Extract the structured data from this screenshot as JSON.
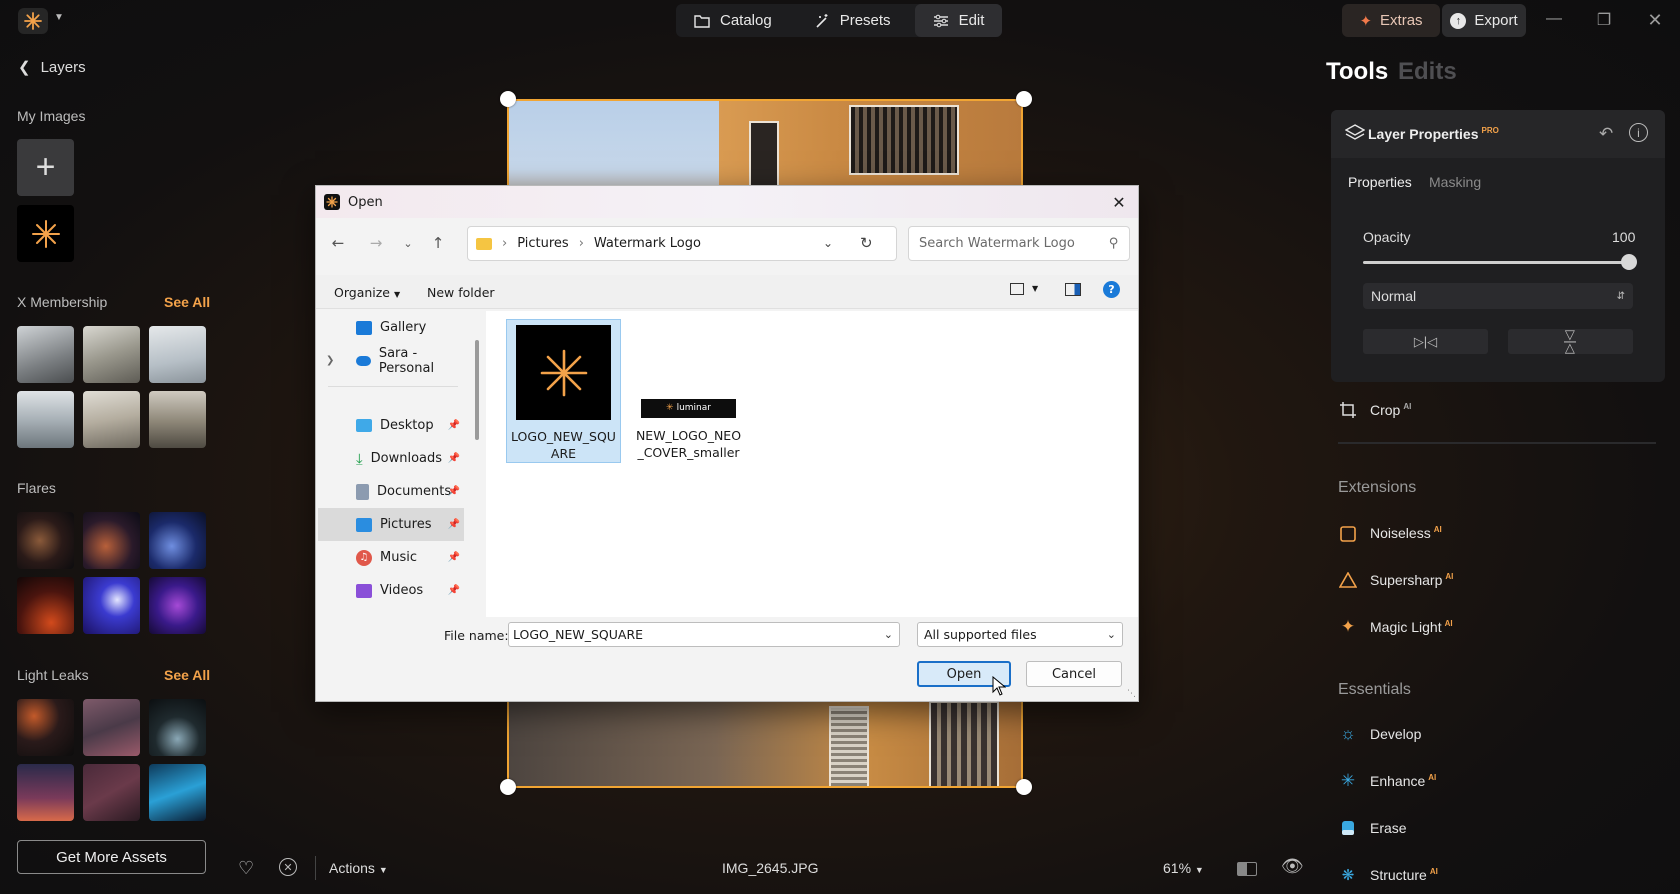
{
  "topbar": {
    "nav": [
      {
        "label": "Catalog",
        "icon": "folder-icon"
      },
      {
        "label": "Presets",
        "icon": "magic-wand-icon"
      },
      {
        "label": "Edit",
        "icon": "sliders-icon"
      }
    ],
    "extras_label": "Extras",
    "export_label": "Export"
  },
  "left_panel": {
    "back_label": "Layers",
    "my_images_heading": "My Images",
    "membership_heading": "X Membership",
    "see_all": "See All",
    "flares_heading": "Flares",
    "light_leaks_heading": "Light Leaks",
    "get_more_label": "Get More Assets"
  },
  "right_panel": {
    "tools_tab": "Tools",
    "edits_tab": "Edits",
    "layer_properties_title": "Layer Properties",
    "pro_badge": "PRO",
    "ai_badge": "AI",
    "tabs": [
      "Properties",
      "Masking"
    ],
    "opacity_label": "Opacity",
    "opacity_value": "100",
    "opacity_fraction": 1.0,
    "blend_mode": "Normal",
    "crop_label": "Crop",
    "extensions_heading": "Extensions",
    "extensions": [
      "Noiseless",
      "Supersharp",
      "Magic Light"
    ],
    "essentials_heading": "Essentials",
    "essentials": [
      "Develop",
      "Enhance",
      "Erase",
      "Structure"
    ]
  },
  "bottom_bar": {
    "actions_label": "Actions",
    "filename": "IMG_2645.JPG",
    "zoom": "61%"
  },
  "dialog": {
    "title": "Open",
    "breadcrumb": [
      "Pictures",
      "Watermark Logo"
    ],
    "search_placeholder": "Search Watermark Logo",
    "organize_label": "Organize",
    "new_folder_label": "New folder",
    "nav_items": [
      {
        "label": "Gallery",
        "pinned": false
      },
      {
        "label": "Sara - Personal",
        "pinned": false
      },
      {
        "label": "Desktop",
        "pinned": true
      },
      {
        "label": "Downloads",
        "pinned": true
      },
      {
        "label": "Documents",
        "pinned": true
      },
      {
        "label": "Pictures",
        "pinned": true,
        "selected": true
      },
      {
        "label": "Music",
        "pinned": true
      },
      {
        "label": "Videos",
        "pinned": true
      }
    ],
    "files": [
      {
        "name_line1": "LOGO_NEW_SQU",
        "name_line2": "ARE",
        "selected": true
      },
      {
        "name_line1": "NEW_LOGO_NEO",
        "name_line2": "_COVER_smaller",
        "thumb_text": "luminar",
        "selected": false
      }
    ],
    "file_name_label": "File name:",
    "file_name_value": "LOGO_NEW_SQUARE",
    "file_type": "All supported files",
    "open_label": "Open",
    "cancel_label": "Cancel"
  },
  "colors": {
    "accent": "#f3a24a",
    "crop_frame": "#f1a533",
    "dialog_selection": "#cce4f7"
  }
}
